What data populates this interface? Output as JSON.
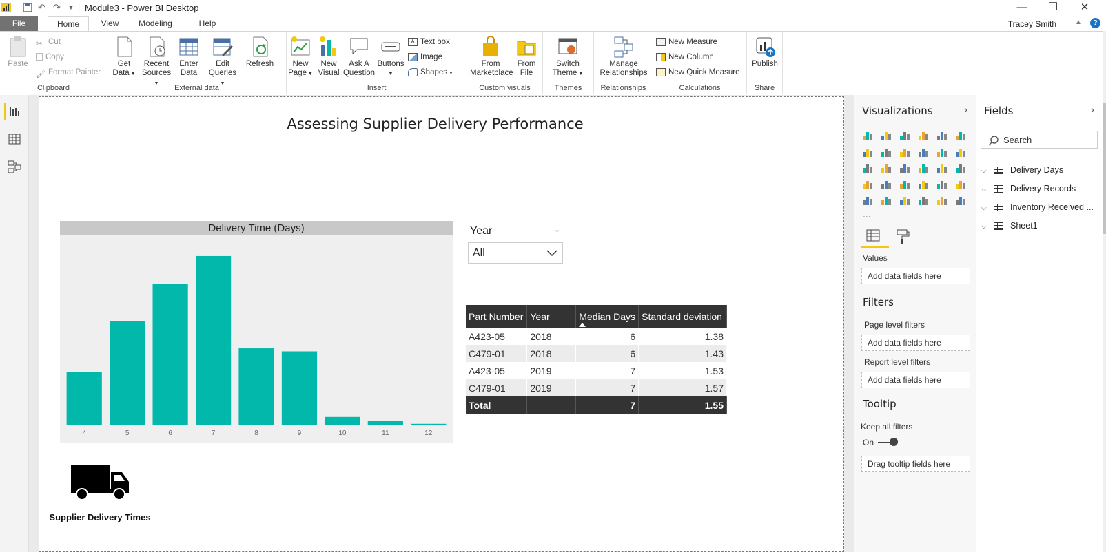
{
  "window": {
    "title": "Module3 - Power BI Desktop",
    "user": "Tracey Smith",
    "help": "?"
  },
  "menu": {
    "file": "File",
    "tabs": [
      "Home",
      "View",
      "Modeling",
      "Help"
    ]
  },
  "ribbon": {
    "clipboard": {
      "paste": "Paste",
      "cut": "Cut",
      "copy": "Copy",
      "format_painter": "Format Painter",
      "label": "Clipboard"
    },
    "external_data": {
      "get_data": "Get\nData",
      "recent_sources": "Recent\nSources",
      "enter_data": "Enter\nData",
      "edit_queries": "Edit\nQueries",
      "refresh": "Refresh",
      "label": "External data"
    },
    "insert": {
      "new_page": "New\nPage",
      "new_visual": "New\nVisual",
      "ask_question": "Ask A\nQuestion",
      "buttons": "Buttons",
      "text_box": "Text box",
      "image": "Image",
      "shapes": "Shapes",
      "label": "Insert"
    },
    "custom_visuals": {
      "from_marketplace": "From\nMarketplace",
      "from_file": "From\nFile",
      "label": "Custom visuals"
    },
    "themes": {
      "switch_theme": "Switch\nTheme",
      "label": "Themes"
    },
    "relationships": {
      "manage": "Manage\nRelationships",
      "label": "Relationships"
    },
    "calculations": {
      "new_measure": "New Measure",
      "new_column": "New Column",
      "new_quick_measure": "New Quick Measure",
      "label": "Calculations"
    },
    "share": {
      "publish": "Publish",
      "label": "Share"
    }
  },
  "report": {
    "title": "Assessing Supplier Delivery Performance",
    "slicer": {
      "label": "Year",
      "value": "All"
    },
    "table": {
      "headers": [
        "Part Number",
        "Year",
        "Median Days",
        "Standard deviation"
      ],
      "rows": [
        [
          "A423-05",
          "2018",
          "6",
          "1.38"
        ],
        [
          "C479-01",
          "2018",
          "6",
          "1.43"
        ],
        [
          "A423-05",
          "2019",
          "7",
          "1.53"
        ],
        [
          "C479-01",
          "2019",
          "7",
          "1.57"
        ]
      ],
      "total": [
        "Total",
        "",
        "7",
        "1.55"
      ]
    },
    "image_caption": "Supplier Delivery Times"
  },
  "chart_data": {
    "type": "bar",
    "title": "Delivery Time (Days)",
    "categories": [
      "4",
      "5",
      "6",
      "7",
      "8",
      "9",
      "10",
      "11",
      "12"
    ],
    "values": [
      70,
      137,
      185,
      222,
      101,
      97,
      11,
      6,
      2
    ],
    "ylim": [
      0,
      240
    ],
    "color": "#01b8aa",
    "grid": false
  },
  "viz_pane": {
    "title": "Visualizations",
    "more": "...",
    "values_label": "Values",
    "values_well": "Add data fields here",
    "filters_title": "Filters",
    "page_filters": "Page level filters",
    "page_well": "Add data fields here",
    "report_filters": "Report level filters",
    "report_well": "Add data fields here",
    "tooltip_title": "Tooltip",
    "keep_filters": "Keep all filters",
    "toggle": "On",
    "tooltip_well": "Drag tooltip fields here",
    "accent": "#f2c811"
  },
  "fields_pane": {
    "title": "Fields",
    "search_placeholder": "Search",
    "tables": [
      "Delivery Days",
      "Delivery Records",
      "Inventory Received ...",
      "Sheet1"
    ]
  }
}
